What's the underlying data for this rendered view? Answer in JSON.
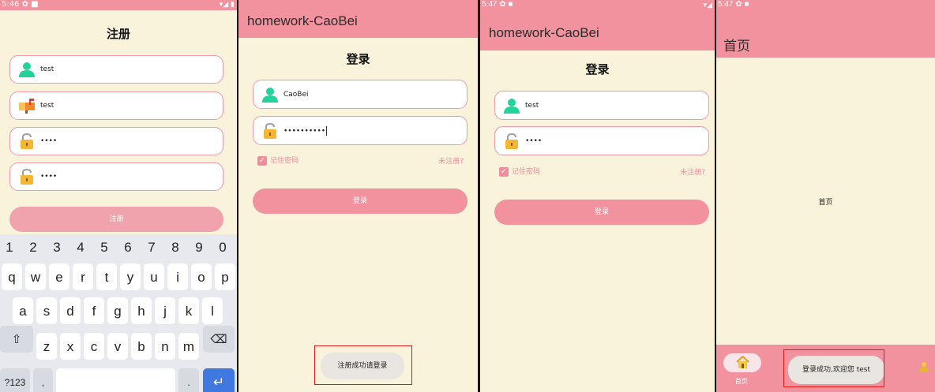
{
  "colors": {
    "accent": "#f2929e",
    "background": "#faf3dc",
    "highlight": "#e11818",
    "checkbox": "#ef8d9b"
  },
  "screen1": {
    "status_time": "5:46",
    "status_icons": "✿ ■",
    "status_right": "▾◢ ▮",
    "title": "注册",
    "username_icon": "user-icon",
    "username_value": "test",
    "email_icon": "mailbox-icon",
    "email_value": "test",
    "password_icon": "lock-icon",
    "password_value": "••••",
    "confirm_value": "••••",
    "register_button": "注册",
    "keyboard": {
      "numbers": [
        "1",
        "2",
        "3",
        "4",
        "5",
        "6",
        "7",
        "8",
        "9",
        "0"
      ],
      "row1": [
        "q",
        "w",
        "e",
        "r",
        "t",
        "y",
        "u",
        "i",
        "o",
        "p"
      ],
      "row2": [
        "a",
        "s",
        "d",
        "f",
        "g",
        "h",
        "j",
        "k",
        "l"
      ],
      "row3": [
        "z",
        "x",
        "c",
        "v",
        "b",
        "n",
        "m"
      ],
      "shift": "⇧",
      "backspace": "⌫",
      "symbols": "?123",
      "comma": ",",
      "period": ".",
      "enter": "↵"
    }
  },
  "screen2": {
    "app_title": "homework-CaoBei",
    "heading": "登录",
    "username_value": "CaoBei",
    "password_value": "••••••••••",
    "remember_label": "记住密码",
    "register_link": "未注册?",
    "login_button": "登录",
    "toast": "注册成功请登录"
  },
  "screen3": {
    "status_time": "5:47",
    "status_icons": "✿ ■",
    "status_right": "▾◢",
    "app_title": "homework-CaoBei",
    "heading": "登录",
    "username_value": "test",
    "password_value": "••••",
    "remember_label": "记住密码",
    "register_link": "未注册?",
    "login_button": "登录"
  },
  "screen4": {
    "status_time": "5:47",
    "status_icons": "✿ ■",
    "title": "首页",
    "content": "首页",
    "nav_home_label": "首页",
    "toast": "登录成功,欢迎您 test"
  }
}
